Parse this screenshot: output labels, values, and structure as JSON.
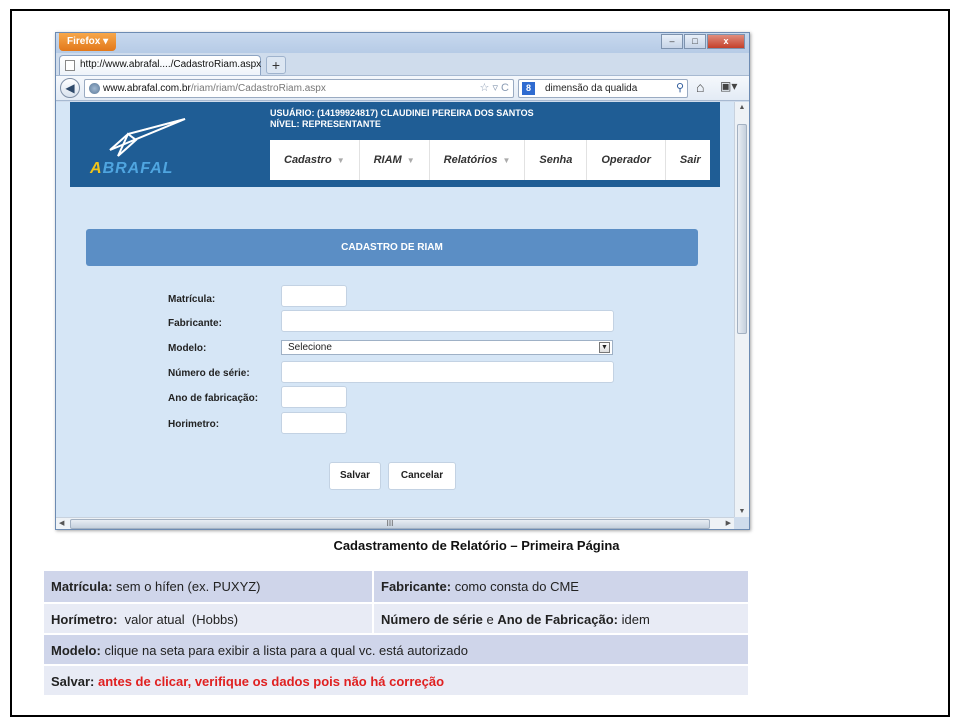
{
  "browser": {
    "app_button": "Firefox",
    "tab_title": "http://www.abrafal..../CadastroRiam.aspx",
    "new_tab": "+",
    "url_domain": "www.abrafal.com.br",
    "url_path": "/riam/riam/CadastroRiam.aspx",
    "url_prefix": "www.",
    "search_text": "dimensão da qualida",
    "search_engine_icon": "google-icon",
    "win_minimize": "–",
    "win_maximize": "□",
    "win_close": "x"
  },
  "site": {
    "logo": "ABRAFAL",
    "logo_first": "A",
    "logo_rest": "BRAFAL",
    "user_line": "USUÁRIO: (14199924817) CLAUDINEI PEREIRA DOS SANTOS",
    "level_line": "NÍVEL: REPRESENTANTE",
    "menu": [
      {
        "label": "Cadastro",
        "has_caret": true
      },
      {
        "label": "RIAM",
        "has_caret": true
      },
      {
        "label": "Relatórios",
        "has_caret": true
      },
      {
        "label": "Senha",
        "has_caret": false
      },
      {
        "label": "Operador",
        "has_caret": false
      },
      {
        "label": "Sair",
        "has_caret": false
      }
    ]
  },
  "form": {
    "panel_title": "CADASTRO DE RIAM",
    "labels": {
      "matricula": "Matrícula:",
      "fabricante": "Fabricante:",
      "modelo": "Modelo:",
      "numero_serie": "Número de série:",
      "ano_fabricacao": "Ano de fabricação:",
      "horimetro": "Horimetro:"
    },
    "values": {
      "matricula": "",
      "fabricante": "",
      "modelo": "Selecione",
      "numero_serie": "",
      "ano_fabricacao": "",
      "horimetro": ""
    },
    "save_label": "Salvar",
    "cancel_label": "Cancelar"
  },
  "caption": "Cadastramento de Relatório – Primeira Página",
  "table": {
    "r1c1_bold": "Matrícula:",
    "r1c1_text": " sem o hífen (ex. PUXYZ)",
    "r1c2_bold": "Fabricante:",
    "r1c2_text": " como consta do CME",
    "r2c1_bold": "Horímetro:",
    "r2c1_text": "  valor atual  (Hobbs)",
    "r2c2_bold1": "Número de série",
    "r2c2_mid": " e ",
    "r2c2_bold2": "Ano de Fabricação:",
    "r2c2_text": " idem",
    "r3_bold": "Modelo:",
    "r3_text": " clique na seta para exibir a lista para a qual vc. está autorizado",
    "r4_bold": "Salvar:",
    "r4_red": " antes de clicar, verifique os dados pois não há correção"
  },
  "colors": {
    "header_blue": "#1f5d95",
    "panel_blue": "#5b8ec5",
    "page_bg": "#d6e6f6",
    "warning_red": "#e02020"
  }
}
